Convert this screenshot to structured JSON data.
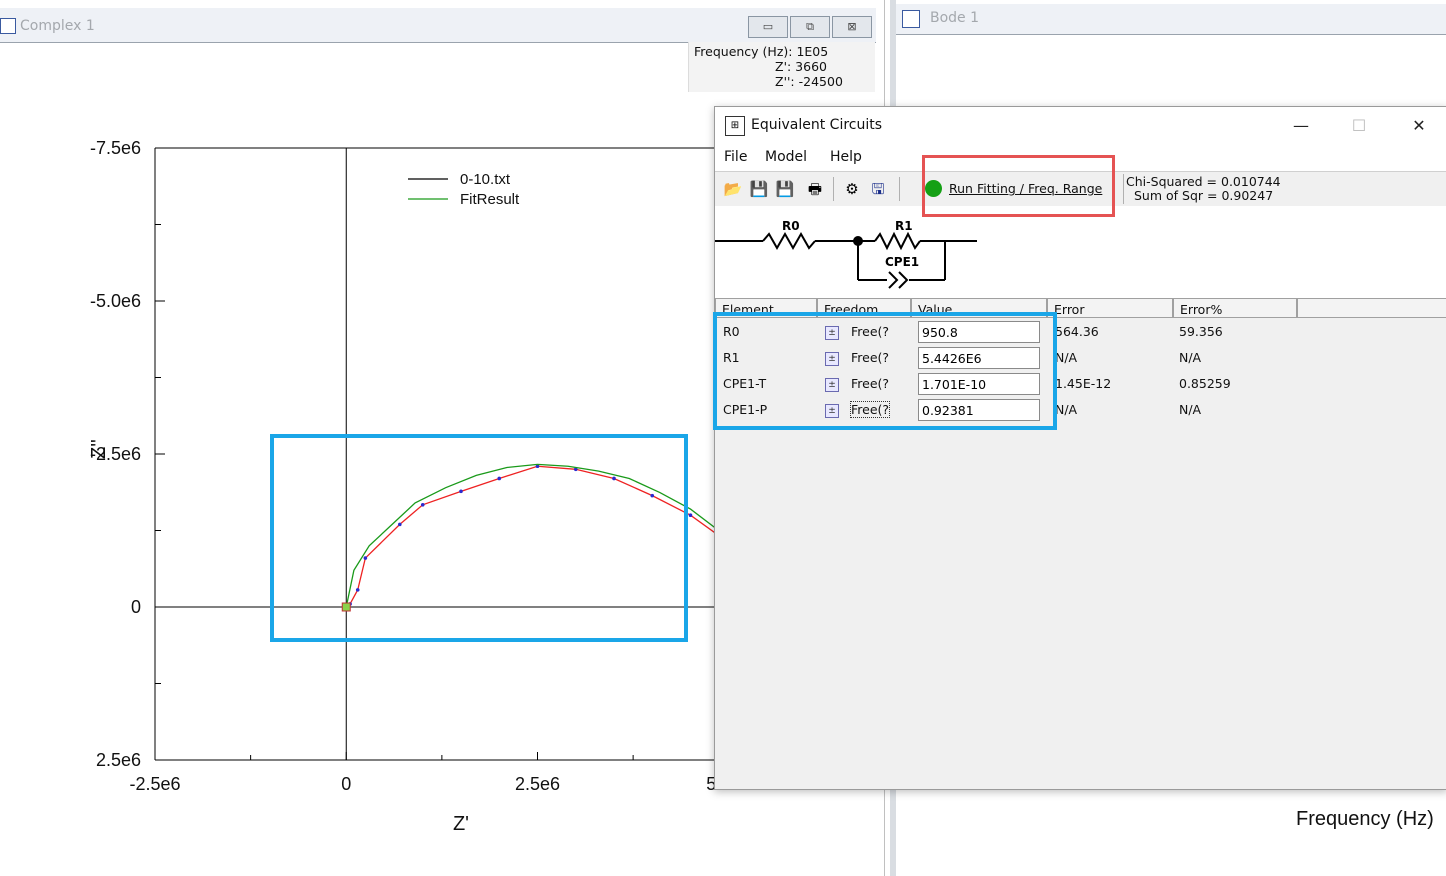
{
  "complex_window": {
    "title": "Complex 1",
    "controls": {
      "minimize": "▭",
      "restore": "⧉",
      "close": "⊠"
    },
    "readout": {
      "frequency": "Frequency (Hz): 1E05",
      "z_real": "Z': 3660",
      "z_imag": "Z'': -24500"
    }
  },
  "chart_data": {
    "type": "scatter",
    "xlabel": "Z'",
    "ylabel": "Z''",
    "xlim": [
      -2500000,
      5500000
    ],
    "ylim": [
      2500000,
      -7500000
    ],
    "x_ticks": [
      "-2.5e6",
      "0",
      "2.5e6",
      "5.0e6"
    ],
    "y_ticks": [
      "-7.5e6",
      "-5.0e6",
      "-2.5e6",
      "0",
      "2.5e6"
    ],
    "legend": [
      "0-10.txt",
      "FitResult"
    ],
    "series": [
      {
        "name": "0-10.txt",
        "color": "#ee2222",
        "x": [
          0,
          50000,
          150000,
          250000,
          700000,
          1000000,
          1500000,
          2000000,
          2500000,
          3000000,
          3500000,
          4000000,
          4500000,
          5000000,
          5200000,
          5350000,
          5500000,
          5600000,
          5700000
        ],
        "y": [
          0,
          -50000,
          -280000,
          -800000,
          -1350000,
          -1670000,
          -1890000,
          -2100000,
          -2300000,
          -2250000,
          -2100000,
          -1820000,
          -1500000,
          -1050000,
          -750000,
          -420000,
          -150000,
          -50000,
          -20000
        ]
      },
      {
        "name": "FitResult",
        "color": "#1a9a1a",
        "x": [
          0,
          100000,
          300000,
          600000,
          900000,
          1300000,
          1700000,
          2100000,
          2500000,
          2900000,
          3300000,
          3700000,
          4100000,
          4500000,
          4900000,
          5200000,
          5400000,
          5500000,
          5550000
        ],
        "y": [
          0,
          -600000,
          -1000000,
          -1350000,
          -1700000,
          -1950000,
          -2150000,
          -2280000,
          -2330000,
          -2300000,
          -2220000,
          -2100000,
          -1870000,
          -1600000,
          -1220000,
          -850000,
          -450000,
          -200000,
          -20000
        ]
      }
    ]
  },
  "bode_window": {
    "title": "Bode 1",
    "xlabel": "Frequency (Hz)"
  },
  "eq_dialog": {
    "title": "Equivalent Circuits",
    "menu": {
      "file": "File",
      "model": "Model",
      "help": "Help"
    },
    "run_fitting": "Run Fitting / Freq. Range",
    "chi_squared": "Chi-Squared = 0.010744",
    "sum_sqr": "Sum of Sqr = 0.90247",
    "circuit": {
      "r0": "R0",
      "r1": "R1",
      "cpe1": "CPE1"
    },
    "table": {
      "headers": [
        "Element",
        "Freedom",
        "Value",
        "Error",
        "Error%"
      ],
      "rows": [
        {
          "element": "R0",
          "freedom": "Free(?",
          "value": "950.8",
          "error": "564.36",
          "error_pct": "59.356"
        },
        {
          "element": "R1",
          "freedom": "Free(?",
          "value": "5.4426E6",
          "error": "N/A",
          "error_pct": "N/A"
        },
        {
          "element": "CPE1-T",
          "freedom": "Free(?",
          "value": "1.701E-10",
          "error": "1.45E-12",
          "error_pct": "0.85259"
        },
        {
          "element": "CPE1-P",
          "freedom": "Free(?",
          "value": "0.92381",
          "error": "N/A",
          "error_pct": "N/A"
        }
      ]
    }
  }
}
